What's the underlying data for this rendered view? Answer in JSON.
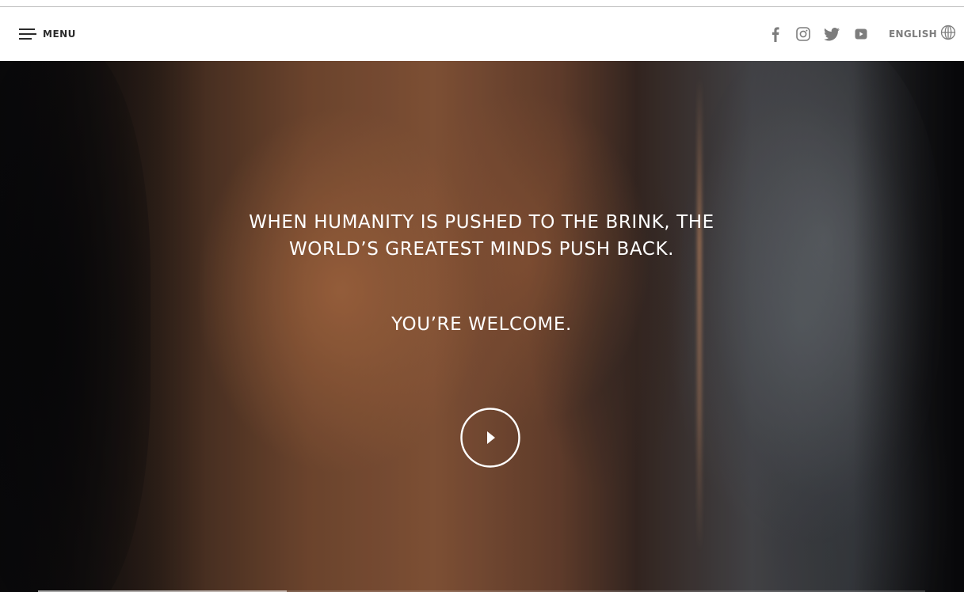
{
  "header": {
    "menu_label": "MENU",
    "language_label": "ENGLISH",
    "social": [
      {
        "name": "facebook",
        "icon": "facebook-icon"
      },
      {
        "name": "instagram",
        "icon": "instagram-icon"
      },
      {
        "name": "twitter",
        "icon": "twitter-icon"
      },
      {
        "name": "youtube",
        "icon": "youtube-icon"
      }
    ],
    "social_icon_color": "#7d7d7d",
    "menu_color": "#2b2b2b"
  },
  "hero": {
    "headline_line1": "WHEN HUMANITY IS PUSHED TO THE BRINK, THE",
    "headline_line2": "WORLD’S GREATEST MINDS PUSH BACK.",
    "subline": "YOU’RE WELCOME.",
    "play_icon": "play-icon",
    "text_color": "#ffffff",
    "progress_fraction": 0.28
  }
}
